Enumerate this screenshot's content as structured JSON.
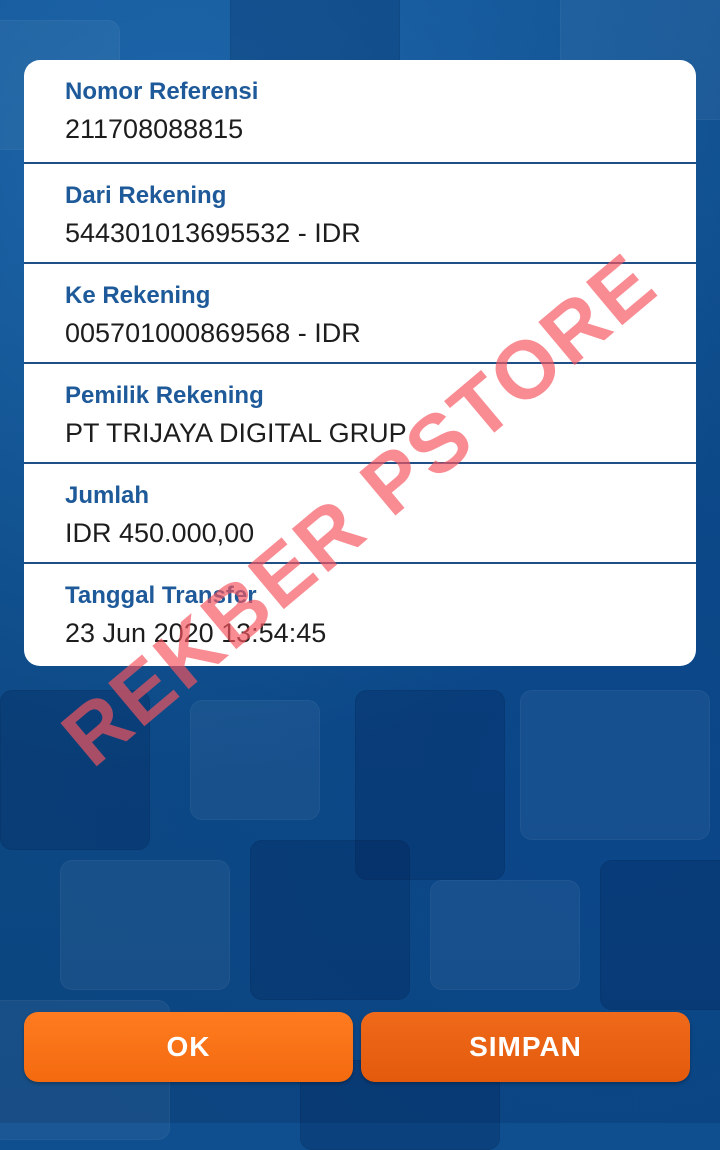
{
  "details": [
    {
      "label": "Nomor Referensi",
      "value": "211708088815"
    },
    {
      "label": "Dari Rekening",
      "value": "544301013695532 - IDR"
    },
    {
      "label": "Ke Rekening",
      "value": "005701000869568 - IDR"
    },
    {
      "label": "Pemilik Rekening",
      "value": "PT TRIJAYA DIGITAL GRUP"
    },
    {
      "label": "Jumlah",
      "value": "IDR 450.000,00"
    },
    {
      "label": "Tanggal Transfer",
      "value": "23 Jun 2020 13:54:45"
    }
  ],
  "watermark": "REKBER PSTORE",
  "buttons": {
    "ok": "OK",
    "save": "SIMPAN"
  },
  "colors": {
    "label": "#1e5a99",
    "divider": "#1f4f86",
    "button": "#f46a0f",
    "watermark": "#f5555f"
  }
}
